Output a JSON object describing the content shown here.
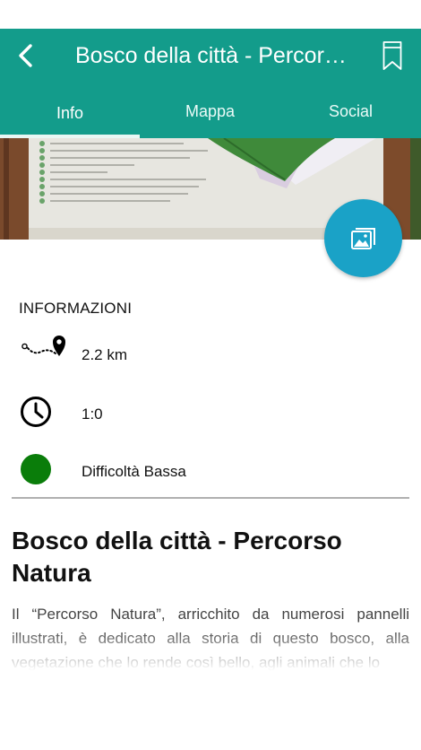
{
  "header": {
    "title": "Bosco della città - Percorso Natura",
    "back_icon": "chevron-left-icon",
    "bookmark_icon": "bookmark-icon",
    "color": "#139c8b"
  },
  "tabs": [
    {
      "label": "Info",
      "selected": true
    },
    {
      "label": "Mappa",
      "selected": false
    },
    {
      "label": "Social",
      "selected": false
    }
  ],
  "fab": {
    "icon": "image-gallery-icon",
    "color": "#1aa2c7"
  },
  "info": {
    "section_label": "INFORMAZIONI",
    "distance": "2.2 km",
    "duration": "1:0",
    "difficulty": "Difficoltà Bassa",
    "difficulty_color": "#0a7d0a"
  },
  "content": {
    "heading": "Bosco della città - Percorso Natura",
    "description": "Il “Percorso Natura”, arricchito da numerosi pannelli illustrati, è dedicato alla storia di questo bosco, alla vegetazione che lo rende così bello, agli animali che lo"
  }
}
